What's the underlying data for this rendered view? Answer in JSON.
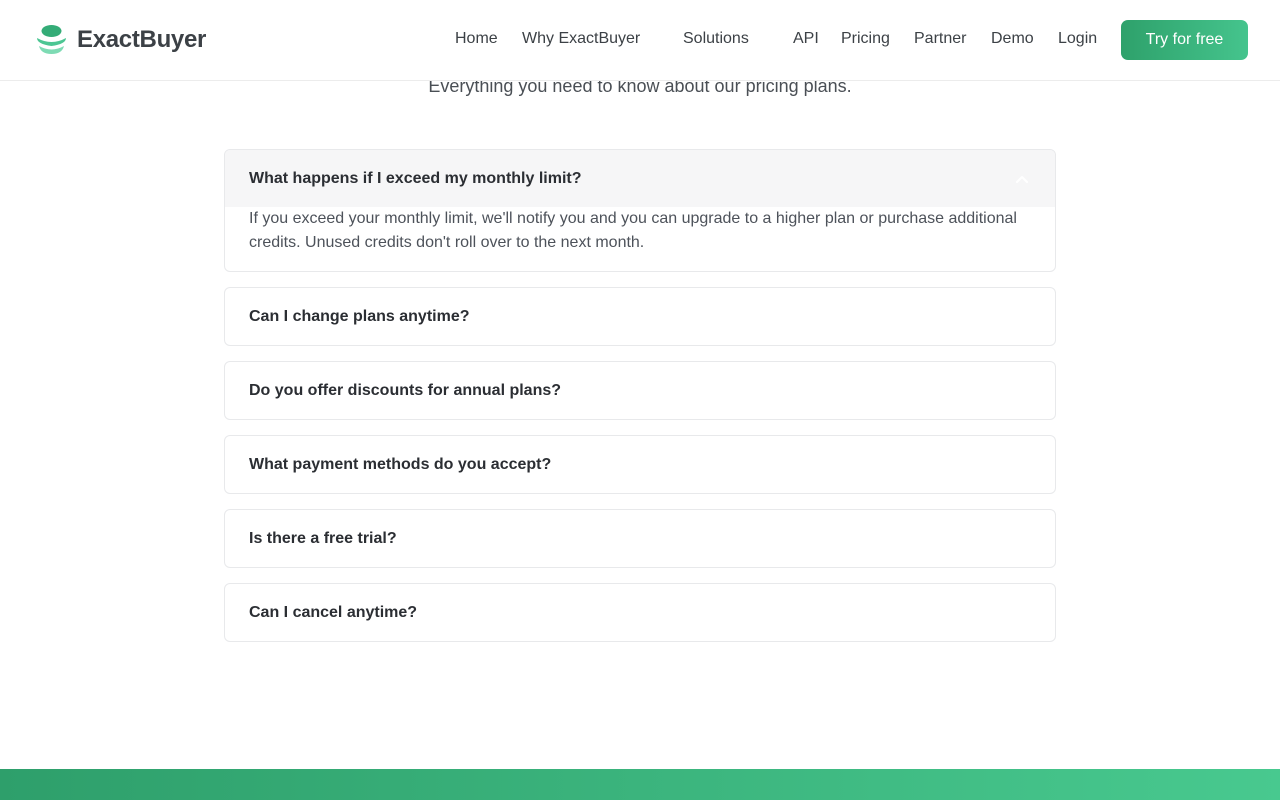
{
  "brand": {
    "name": "ExactBuyer",
    "accent": "#34ac77"
  },
  "nav": {
    "items": [
      "Home",
      "Why ExactBuyer",
      "Solutions",
      "API",
      "Pricing",
      "Partner",
      "Demo",
      "Login"
    ],
    "cta": "Try for free"
  },
  "section": {
    "subtitle": "Everything you need to know about our pricing plans."
  },
  "faqs": [
    {
      "question": "What happens if I exceed my monthly limit?",
      "answer": "If you exceed your monthly limit, we'll notify you and you can upgrade to a higher plan or purchase additional credits. Unused credits don't roll over to the next month.",
      "expanded": true,
      "icon": "chevron-up-icon"
    },
    {
      "question": "Can I change plans anytime?",
      "expanded": false
    },
    {
      "question": "Do you offer discounts for annual plans?",
      "expanded": false
    },
    {
      "question": "What payment methods do you accept?",
      "expanded": false
    },
    {
      "question": "Is there a free trial?",
      "expanded": false
    },
    {
      "question": "Can I cancel anytime?",
      "expanded": false
    }
  ]
}
